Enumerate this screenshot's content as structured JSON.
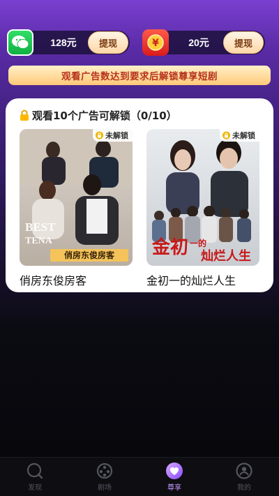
{
  "wallet": {
    "wechat": {
      "icon": "wechat-icon",
      "amount": "128元",
      "button": "提现"
    },
    "cash": {
      "icon": "yuan-coin-icon",
      "amount": "20元",
      "button": "提现"
    }
  },
  "banner": "观看广告数达到要求后解锁尊享短剧",
  "card": {
    "title": "观看10个广告可解锁（0/10）",
    "lock_icon": "lock-icon",
    "dramas": [
      {
        "title": "俏房东俊房客",
        "badge": "未解锁",
        "poster_caption": "俏房东俊房客",
        "poster_english": "BEST TENANT"
      },
      {
        "title": "金初一的灿烂人生",
        "badge": "未解锁",
        "poster_caption": "金初一的灿烂人生"
      }
    ]
  },
  "nav": {
    "active": "尊享",
    "items": [
      {
        "label": "发现",
        "icon": "discover-icon"
      },
      {
        "label": "剧场",
        "icon": "film-reel-icon"
      },
      {
        "label": "尊享",
        "icon": "heart-icon"
      },
      {
        "label": "我的",
        "icon": "profile-icon"
      }
    ]
  },
  "colors": {
    "accent": "#c69bff",
    "banner_text": "#b5321d",
    "withdraw_bg": "#ffd8a8"
  }
}
